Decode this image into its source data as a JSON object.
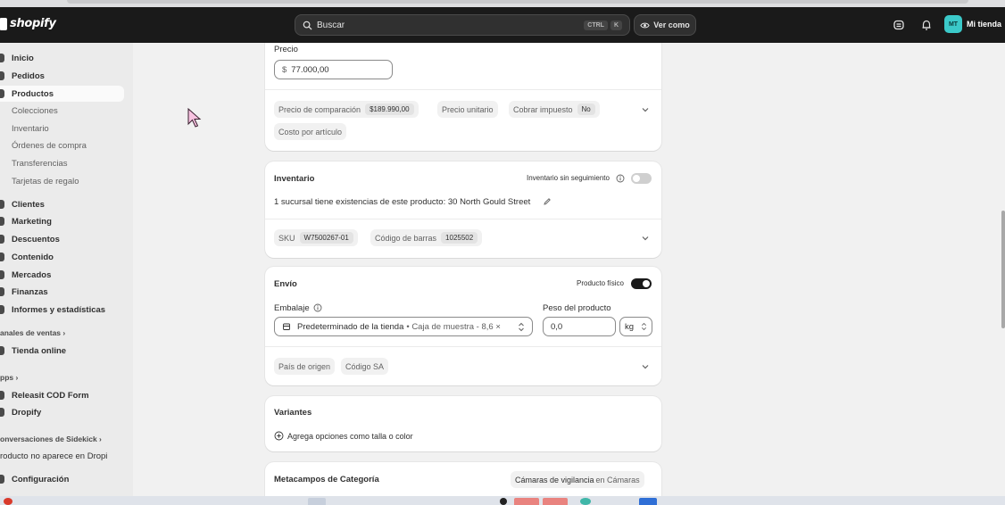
{
  "topbar": {
    "brand": "shopify",
    "search_placeholder": "Buscar",
    "shortcut_ctrl": "CTRL",
    "shortcut_k": "K",
    "view_as": "Ver como",
    "store_initials": "MT",
    "store_name": "Mi tienda"
  },
  "sidebar": {
    "main": [
      "Inicio",
      "Pedidos",
      "Productos"
    ],
    "products_sub": [
      "Colecciones",
      "Inventario",
      "Órdenes de compra",
      "Transferencias",
      "Tarjetas de regalo"
    ],
    "more": [
      "Clientes",
      "Marketing",
      "Descuentos",
      "Contenido",
      "Mercados",
      "Finanzas",
      "Informes y estadísticas"
    ],
    "sales_channels_head": "anales de ventas",
    "sales_channels": [
      "Tienda online"
    ],
    "apps_head": "pps",
    "apps": [
      "Releasit COD Form",
      "Dropify"
    ],
    "sidekick_head": "onversaciones de Sidekick",
    "sidekick_item": "roducto no aparece en Dropi",
    "settings": "Configuración"
  },
  "pricing": {
    "price_label": "Precio",
    "currency_symbol": "$",
    "price_value": "77.000,00",
    "compare_label": "Precio de comparación",
    "compare_value": "$189.990,00",
    "unit_price_label": "Precio unitario",
    "charge_tax_label": "Cobrar impuesto",
    "charge_tax_value": "No",
    "cost_label": "Costo por artículo"
  },
  "inventory": {
    "title": "Inventario",
    "untracked_label": "Inventario sin seguimiento",
    "untracked_on": false,
    "stock_text": "1 sucursal tiene existencias de este producto: 30 North Gould Street",
    "sku_label": "SKU",
    "sku_value": "W7500267-01",
    "barcode_label": "Código de barras",
    "barcode_value": "1025502"
  },
  "shipping": {
    "title": "Envío",
    "physical_label": "Producto físico",
    "physical_on": true,
    "packaging_label": "Embalaje",
    "packaging_value": "Predeterminado de la tienda",
    "packaging_detail": "• Caja de muestra - 8,6 ×",
    "weight_label": "Peso del producto",
    "weight_value": "0,0",
    "weight_unit": "kg",
    "origin_label": "País de origen",
    "hs_label": "Código SA"
  },
  "variants": {
    "title": "Variantes",
    "add_options": "Agrega opciones como talla o color"
  },
  "metafields": {
    "title": "Metacampos de Categoría",
    "category": "Cámaras de vigilancia",
    "category_suffix": "en Cámaras"
  },
  "colors": {
    "topbar": "#1a1a1a",
    "accent_avatar": "#3bc9c9",
    "toggle_on": "#1a1a1a"
  }
}
